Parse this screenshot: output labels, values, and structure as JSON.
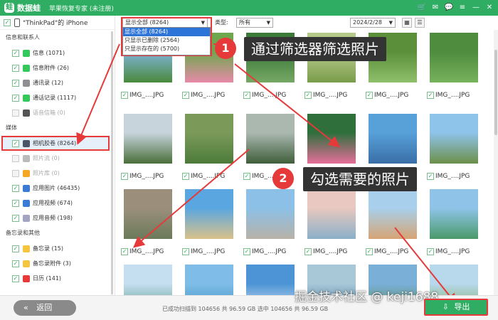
{
  "titlebar": {
    "logo_mark": "蛙",
    "app_name": "数据蛙",
    "subtitle": "苹果恢复专家 (未注册)",
    "icons": [
      "cart-icon",
      "gift-icon",
      "chat-icon",
      "menu-icon",
      "minimize-icon",
      "close-icon"
    ],
    "icon_glyphs": [
      "🛒",
      "✉",
      "💬",
      "≡",
      "—",
      "✕"
    ],
    "brand_color": "#2fae63"
  },
  "sidebar": {
    "device_label": "\"ThinkPad\"的 iPhone",
    "sections": [
      {
        "title": "信息和联系人",
        "items": [
          {
            "label": "信息 (1071)",
            "icon": "message-icon",
            "color": "#34c759",
            "checked": true,
            "enabled": true
          },
          {
            "label": "信息附件 (26)",
            "icon": "attachment-icon",
            "color": "#34c759",
            "checked": true,
            "enabled": true
          },
          {
            "label": "通讯录 (12)",
            "icon": "contacts-icon",
            "color": "#8e8e93",
            "checked": true,
            "enabled": true
          },
          {
            "label": "通话记录 (1117)",
            "icon": "call-history-icon",
            "color": "#34c759",
            "checked": true,
            "enabled": true
          },
          {
            "label": "语音信箱 (0)",
            "icon": "voicemail-icon",
            "color": "#555555",
            "checked": false,
            "enabled": false
          }
        ]
      },
      {
        "title": "媒体",
        "items": [
          {
            "label": "相机胶卷 (8264)",
            "icon": "camera-icon",
            "color": "#4a5568",
            "checked": true,
            "enabled": true,
            "selected": true
          },
          {
            "label": "照片流 (0)",
            "icon": "photostream-icon",
            "color": "#bbbbbb",
            "checked": false,
            "enabled": false
          },
          {
            "label": "照片库 (0)",
            "icon": "photo-library-icon",
            "color": "#f5a623",
            "checked": false,
            "enabled": false
          },
          {
            "label": "应用图片 (46435)",
            "icon": "app-photos-icon",
            "color": "#3a7bd5",
            "checked": true,
            "enabled": true
          },
          {
            "label": "应用视频 (674)",
            "icon": "app-videos-icon",
            "color": "#3a7bd5",
            "checked": true,
            "enabled": true
          },
          {
            "label": "应用音频 (198)",
            "icon": "app-audio-icon",
            "color": "#a3a3c2",
            "checked": true,
            "enabled": true
          }
        ]
      },
      {
        "title": "备忘录和其他",
        "items": [
          {
            "label": "备忘录 (15)",
            "icon": "notes-icon",
            "color": "#f5c542",
            "checked": true,
            "enabled": true
          },
          {
            "label": "备忘录附件 (3)",
            "icon": "notes-attachment-icon",
            "color": "#f5c542",
            "checked": true,
            "enabled": true
          },
          {
            "label": "日历 (141)",
            "icon": "calendar-icon",
            "color": "#e63a3a",
            "checked": true,
            "enabled": true
          }
        ]
      }
    ]
  },
  "filter": {
    "main_select": "显示全部 (8264)",
    "options": [
      "显示全部 (8264)",
      "只显示已删除 (2564)",
      "只显示存在的 (5700)"
    ],
    "type_label": "类型:",
    "type_select": "所有",
    "date_select": "2024/2/28"
  },
  "grid": {
    "tiles": [
      {
        "caption": "IMG_....JPG",
        "checked": true,
        "c1": "#7fb3d9",
        "c2": "#4a8a3c"
      },
      {
        "caption": "IMG_....JPG",
        "checked": true,
        "c1": "#6ea84e",
        "c2": "#e78aa8"
      },
      {
        "caption": "IMG_....JPG",
        "checked": true,
        "c1": "#3c7a3a",
        "c2": "#77a865"
      },
      {
        "caption": "IMG_....JPG",
        "checked": true,
        "c1": "#b5c98a",
        "c2": "#7a9c4a"
      },
      {
        "caption": "IMG_....JPG",
        "checked": true,
        "c1": "#5b8f3a",
        "c2": "#8fbf6a"
      },
      {
        "caption": "IMG_....JPG",
        "checked": true,
        "c1": "#4f8c3e",
        "c2": "#77b25c"
      },
      {
        "caption": "IMG_....JPG",
        "checked": true,
        "c1": "#c7d4dc",
        "c2": "#4a6f3a"
      },
      {
        "caption": "IMG_....JPG",
        "checked": true,
        "c1": "#7b9a5a",
        "c2": "#4c7b3a"
      },
      {
        "caption": "IMG_....JPG",
        "checked": true,
        "c1": "#aab8b0",
        "c2": "#3f5e3a"
      },
      {
        "caption": "IMG_....JPG",
        "checked": true,
        "c1": "#2e6f3c",
        "c2": "#e76e9a"
      },
      {
        "caption": "IMG_....JPG",
        "checked": true,
        "c1": "#57a0d8",
        "c2": "#3a6ea8"
      },
      {
        "caption": "IMG_....JPG",
        "checked": true,
        "c1": "#8ec3ea",
        "c2": "#6d8f4a"
      },
      {
        "caption": "IMG_....JPG",
        "checked": true,
        "c1": "#9b8f7c",
        "c2": "#6b7a5a"
      },
      {
        "caption": "IMG_....JPG",
        "checked": true,
        "c1": "#5aa6e0",
        "c2": "#d9c28a"
      },
      {
        "caption": "IMG_....JPG",
        "checked": true,
        "c1": "#8cc0e6",
        "c2": "#b7b2a8"
      },
      {
        "caption": "IMG_....JPG",
        "checked": true,
        "c1": "#e8c8c0",
        "c2": "#8ab0c8"
      },
      {
        "caption": "IMG_....JPG",
        "checked": true,
        "c1": "#a8d0ec",
        "c2": "#d6a474"
      },
      {
        "caption": "IMG_....JPG",
        "checked": true,
        "c1": "#8fc4e8",
        "c2": "#4a9a6a"
      },
      {
        "caption": "",
        "checked": false,
        "c1": "#c5dff0",
        "c2": "#5a9c8a"
      },
      {
        "caption": "",
        "checked": false,
        "c1": "#7fbde8",
        "c2": "#3f8fc0"
      },
      {
        "caption": "",
        "checked": false,
        "c1": "#4c94d6",
        "c2": "#d8e6ef"
      },
      {
        "caption": "",
        "checked": false,
        "c1": "#a8c8d8",
        "c2": "#4a7a9a"
      },
      {
        "caption": "",
        "checked": false,
        "c1": "#7ab0d8",
        "c2": "#5b8a5a"
      },
      {
        "caption": "",
        "checked": false,
        "c1": "#b8d8ec",
        "c2": "#7ab060"
      }
    ]
  },
  "callouts": [
    {
      "number": "1",
      "text": "通过筛选器筛选照片"
    },
    {
      "number": "2",
      "text": "勾选需要的照片"
    }
  ],
  "bottom": {
    "back_label": "返回",
    "status": "已成功扫描到 104656 共 96.59 GB 选中 104656 共 96.59 GB",
    "export_label": "导出",
    "watermark": "掘金技术社区 @ keji1688"
  }
}
